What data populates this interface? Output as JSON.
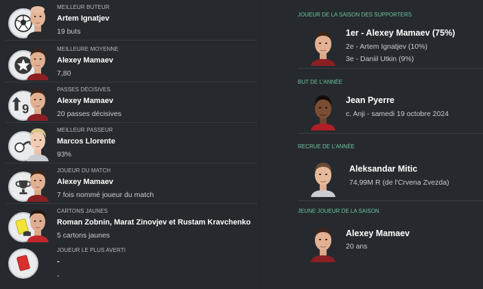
{
  "left_awards": [
    {
      "category": "Meilleur buteur",
      "name": "Artem Ignatjev",
      "detail": "19 buts",
      "icon": "football-icon",
      "face": "bald"
    },
    {
      "category": "Meilleure moyenne",
      "name": "Alexey Mamaev",
      "detail": "7,80",
      "icon": "star-icon",
      "face": "dark"
    },
    {
      "category": "Passes décisives",
      "name": "Alexey Mamaev",
      "detail": "20 passes décisives",
      "icon": "arrow-assist-icon",
      "face": "dark"
    },
    {
      "category": "Meilleur passeur",
      "name": "Marcos Llorente",
      "detail": "93%",
      "icon": "passing-icon",
      "face": "blond"
    },
    {
      "category": "Joueur du match",
      "name": "Alexey Mamaev",
      "detail": "7 fois nommé joueur du match",
      "icon": "trophy-icon",
      "face": "dark"
    },
    {
      "category": "Cartons jaunes",
      "name": "Roman Zobnin, Marat Zinovjev et Rustam Kravchenko",
      "detail": "5 cartons jaunes",
      "icon": "yellow-card-icon",
      "face": "dark-red"
    },
    {
      "category": "Joueur le plus averti",
      "name": "-",
      "detail": "-",
      "icon": "red-card-icon",
      "face": ""
    }
  ],
  "fans_player": {
    "category": "Joueur de la saison des supporters",
    "first": "1er - Alexey Mamaev (75%)",
    "second": "2e - Artem Ignatjev (10%)",
    "third": "3e - Daniil Utkin (9%)"
  },
  "goal_of_year": {
    "category": "But de l'année",
    "name": "Jean Pyerre",
    "detail": "c. Anji - samedi 19 octobre 2024"
  },
  "signing_of_year": {
    "category": "Recrue de l'année",
    "name": "Aleksandar Mitic",
    "detail": "74,99M R (de l'Crvena Zvezda)"
  },
  "young_player": {
    "category": "Jeune joueur de la saison",
    "name": "Alexey Mamaev",
    "detail": "20 ans"
  },
  "colors": {
    "background": "#262a2f",
    "accent": "#6cc4a0",
    "text": "#ffffff"
  }
}
